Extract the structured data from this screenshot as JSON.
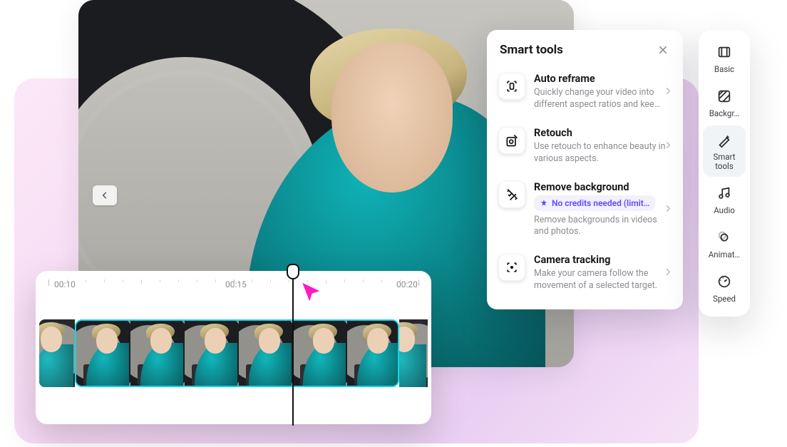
{
  "panel": {
    "title": "Smart tools",
    "badge": "No credits needed (limit…",
    "tools": [
      {
        "title": "Auto reframe",
        "desc": "Quickly change your video into different aspect ratios and kee…"
      },
      {
        "title": "Retouch",
        "desc": "Use retouch to enhance beauty in various aspects."
      },
      {
        "title": "Remove background",
        "desc": "Remove backgrounds in videos and photos."
      },
      {
        "title": "Camera tracking",
        "desc": "Make your camera follow the movement of a selected target."
      }
    ]
  },
  "nav": {
    "items": [
      {
        "label": "Basic"
      },
      {
        "label": "Backgr…"
      },
      {
        "label": "Smart tools"
      },
      {
        "label": "Audio"
      },
      {
        "label": "Animat…"
      },
      {
        "label": "Speed"
      }
    ],
    "active_index": 2
  },
  "timeline": {
    "labels": [
      "00:10",
      "00:15",
      "00:20"
    ]
  }
}
